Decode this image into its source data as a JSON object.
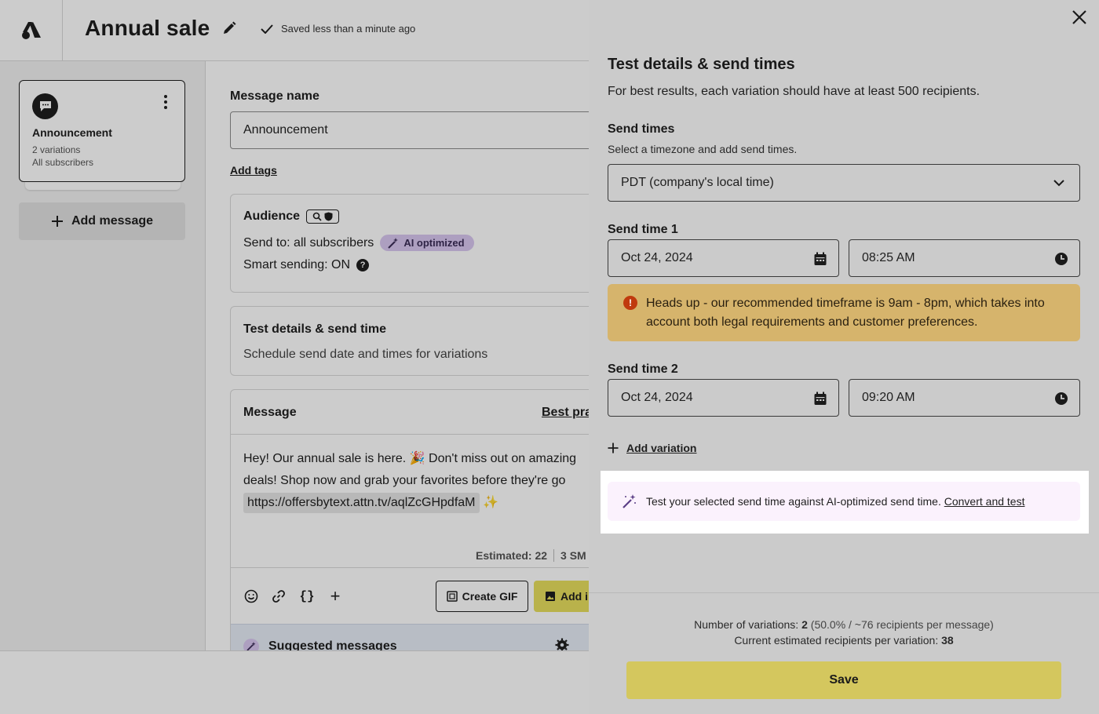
{
  "header": {
    "title": "Annual sale",
    "saved_status": "Saved less than a minute ago"
  },
  "sidebar": {
    "message_card": {
      "title": "Announcement",
      "variations": "2 variations",
      "audience": "All subscribers"
    },
    "add_message_label": "Add message"
  },
  "main": {
    "message_name_label": "Message name",
    "message_name_value": "Announcement",
    "add_tags_label": "Add tags",
    "audience": {
      "title": "Audience",
      "send_to": "Send to: all subscribers",
      "ai_badge": "AI optimized",
      "smart_sending": "Smart sending: ON",
      "help_glyph": "?"
    },
    "test_details": {
      "title": "Test details & send time",
      "subtitle": "Schedule send date and times for variations"
    },
    "message": {
      "title": "Message",
      "best_practices_link": "Best pra",
      "body_line1": "Hey! Our annual sale is here. 🎉 Don't miss out on amazing",
      "body_line2": "deals! Shop now and grab your favorites before they're go",
      "url": "https://offersbytext.attn.tv/aqlZcGHpdfaM",
      "sparkle": "✨",
      "estimated": "Estimated: 22",
      "sms_count": "3 SM",
      "create_gif_label": "Create GIF",
      "add_image_label": "Add i",
      "braces_glyph": "{}",
      "plus_glyph": "+"
    },
    "suggested_messages_label": "Suggested messages"
  },
  "drawer": {
    "title": "Test details & send times",
    "subtitle": "For best results, each variation should have at least 500 recipients.",
    "send_times_label": "Send times",
    "send_times_hint": "Select a timezone and add send times.",
    "timezone_value": "PDT (company's local time)",
    "send_time_1": {
      "label": "Send time 1",
      "date": "Oct 24, 2024",
      "time": "08:25 AM"
    },
    "warning": {
      "icon_glyph": "!",
      "text": "Heads up - our recommended timeframe is 9am - 8pm, which takes into account both legal requirements and customer preferences."
    },
    "send_time_2": {
      "label": "Send time 2",
      "date": "Oct 24, 2024",
      "time": "09:20 AM"
    },
    "add_variation_label": "Add variation",
    "ai_tip": {
      "text": "Test your selected send time against AI-optimized send time. ",
      "link": "Convert and test"
    },
    "footer": {
      "variations_prefix": "Number of variations: ",
      "variations_count": "2",
      "variations_suffix": " (50.0% / ~76 recipients per message)",
      "recipients_prefix": "Current estimated recipients per variation: ",
      "recipients_count": "38"
    },
    "save_label": "Save"
  },
  "colors": {
    "accent_yellow": "#d4c75e",
    "warning_bg": "#d6b46c",
    "ai_badge_bg": "#d9c7f0",
    "ai_tip_bg": "#fbf2fd"
  }
}
